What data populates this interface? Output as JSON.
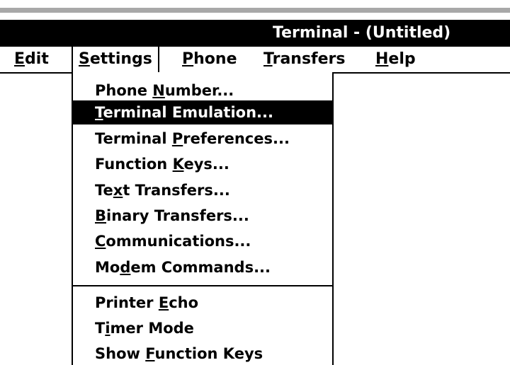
{
  "window": {
    "title": "Terminal - (Untitled)"
  },
  "menu_bar": {
    "items": [
      {
        "pre": "",
        "key": "E",
        "post": "dit"
      },
      {
        "pre": "",
        "key": "S",
        "post": "ettings"
      },
      {
        "pre": "",
        "key": "P",
        "post": "hone"
      },
      {
        "pre": "",
        "key": "T",
        "post": "ransfers"
      },
      {
        "pre": "",
        "key": "H",
        "post": "elp"
      }
    ]
  },
  "settings_menu": {
    "items": [
      {
        "pre": "Phone ",
        "key": "N",
        "post": "umber..."
      },
      {
        "pre": "",
        "key": "T",
        "post": "erminal Emulation..."
      },
      {
        "pre": "Terminal ",
        "key": "P",
        "post": "references..."
      },
      {
        "pre": "Function ",
        "key": "K",
        "post": "eys..."
      },
      {
        "pre": "Te",
        "key": "x",
        "post": "t Transfers..."
      },
      {
        "pre": "",
        "key": "B",
        "post": "inary Transfers..."
      },
      {
        "pre": "",
        "key": "C",
        "post": "ommunications..."
      },
      {
        "pre": "Mo",
        "key": "d",
        "post": "em Commands..."
      },
      {
        "pre": "Printer ",
        "key": "E",
        "post": "cho"
      },
      {
        "pre": "T",
        "key": "i",
        "post": "mer Mode"
      },
      {
        "pre": "Show ",
        "key": "F",
        "post": "unction Keys"
      }
    ],
    "highlighted_index": 1
  },
  "colors": {
    "title_bar": "#000000",
    "highlight": "#000000",
    "band": "#a8a8a8"
  }
}
